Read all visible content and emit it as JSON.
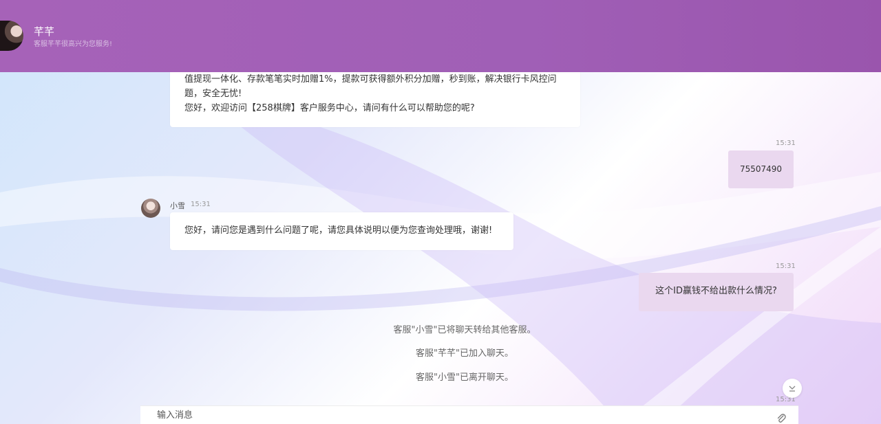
{
  "header": {
    "name": "芊芊",
    "subtitle": "客服芊芊很高兴为您服务!"
  },
  "messages": {
    "welcome": {
      "line1": "值提现一体化、存款笔笔实时加赠1%，提款可获得额外积分加赠，秒到账，解决银行卡风控问",
      "line2": "题，安全无忧!",
      "line3": "您好，欢迎访问【258棋牌】客户服务中心，请问有什么可以帮助您的呢?"
    },
    "user1": {
      "time": "15:31",
      "text": "75507490"
    },
    "agent1": {
      "name": "小雪",
      "time": "15:31",
      "text": "您好，请问您是遇到什么问题了呢，请您具体说明以便为您查询处理哦，谢谢!"
    },
    "user2": {
      "time": "15:31",
      "text": "这个ID赢钱不给出款什么情况?"
    }
  },
  "system_notices": [
    "客服\"小雪\"已将聊天转给其他客服。",
    "客服\"芊芊\"已加入聊天。",
    "客服\"小雪\"已离开聊天。"
  ],
  "last_time": "15:31",
  "input": {
    "placeholder": "输入消息"
  },
  "icons": {
    "scroll_down": "chevron-down-icon",
    "attach": "paperclip-icon"
  }
}
